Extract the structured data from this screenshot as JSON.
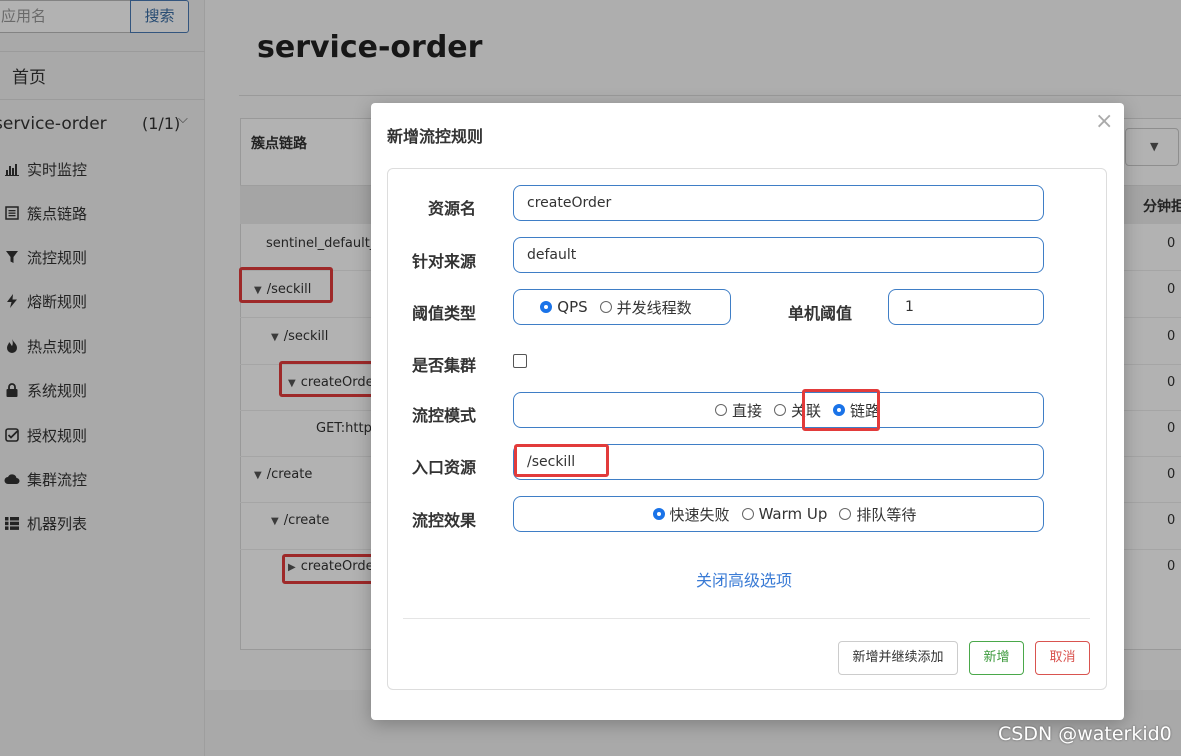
{
  "sidebar": {
    "search_placeholder": "应用名",
    "search_button": "搜索",
    "home": "首页",
    "app_name": "service-order",
    "app_count": "(1/1)",
    "menu": [
      {
        "label": "实时监控",
        "icon": "bar-chart-icon"
      },
      {
        "label": "簇点链路",
        "icon": "list-icon"
      },
      {
        "label": "流控规则",
        "icon": "filter-icon"
      },
      {
        "label": "熔断规则",
        "icon": "bolt-icon"
      },
      {
        "label": "热点规则",
        "icon": "fire-icon"
      },
      {
        "label": "系统规则",
        "icon": "lock-icon"
      },
      {
        "label": "授权规则",
        "icon": "check-square-icon"
      },
      {
        "label": "集群流控",
        "icon": "cloud-icon"
      },
      {
        "label": "机器列表",
        "icon": "th-list-icon"
      }
    ]
  },
  "main": {
    "title": "service-order",
    "panel_title": "簇点链路",
    "column_min": "分钟拒",
    "rows": [
      {
        "label": "sentinel_default_c",
        "caret": "",
        "value": "0"
      },
      {
        "label": "/seckill",
        "caret": "▼",
        "value": "0"
      },
      {
        "label": "/seckill",
        "caret": "▼",
        "value": "0"
      },
      {
        "label": "createOrde",
        "caret": "▼",
        "value": "0"
      },
      {
        "label": "GET:http:",
        "caret": "",
        "value": "0"
      },
      {
        "label": "/create",
        "caret": "▼",
        "value": "0"
      },
      {
        "label": "/create",
        "caret": "▼",
        "value": "0"
      },
      {
        "label": "createOrde",
        "caret": "▶",
        "value": "0"
      }
    ]
  },
  "modal": {
    "title": "新增流控规则",
    "close": "×",
    "resource_label": "资源名",
    "resource_value": "createOrder",
    "source_label": "针对来源",
    "source_value": "default",
    "threshold_type_label": "阈值类型",
    "threshold_type_options": [
      "QPS",
      "并发线程数"
    ],
    "threshold_type_selected": 0,
    "single_threshold_label": "单机阈值",
    "single_threshold_value": "1",
    "cluster_label": "是否集群",
    "mode_label": "流控模式",
    "mode_options": [
      "直接",
      "关联",
      "链路"
    ],
    "mode_selected": 2,
    "entry_label": "入口资源",
    "entry_value": "/seckill",
    "effect_label": "流控效果",
    "effect_options": [
      "快速失败",
      "Warm Up",
      "排队等待"
    ],
    "effect_selected": 0,
    "advanced_link": "关闭高级选项",
    "btn_add_continue": "新增并继续添加",
    "btn_add": "新增",
    "btn_cancel": "取消"
  },
  "watermark": "CSDN @waterkid0",
  "colors": {
    "accent_blue": "#3f7ec6",
    "highlight_red": "#e23b3b",
    "add_green": "#4aa84a",
    "cancel_red": "#d9534f"
  }
}
